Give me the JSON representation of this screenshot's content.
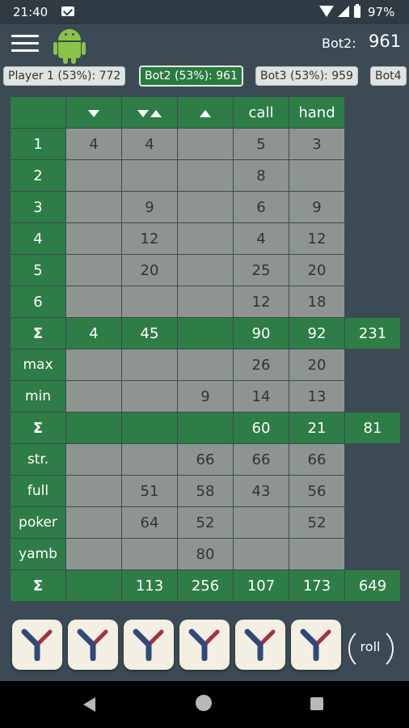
{
  "status_bar": {
    "time": "21:40",
    "battery": "97%"
  },
  "header": {
    "current_player_label": "Bot2:",
    "current_player_score": "961"
  },
  "tabs": [
    {
      "label": "Player 1 (53%): 772",
      "active": false
    },
    {
      "label": "Bot2 (53%): 961",
      "active": true
    },
    {
      "label": "Bot3 (53%): 959",
      "active": false
    },
    {
      "label": "Bot4",
      "active": false
    }
  ],
  "columns": [
    "down-icon",
    "free-icon",
    "up-icon",
    "call",
    "hand"
  ],
  "rows": {
    "1": [
      "4",
      "4",
      "",
      "5",
      "3"
    ],
    "2": [
      "",
      "",
      "",
      "8",
      ""
    ],
    "3": [
      "",
      "9",
      "",
      "6",
      "9"
    ],
    "4": [
      "",
      "12",
      "",
      "4",
      "12"
    ],
    "5": [
      "",
      "20",
      "",
      "25",
      "20"
    ],
    "6": [
      "",
      "",
      "",
      "12",
      "18"
    ],
    "sum1": [
      "4",
      "45",
      "",
      "90",
      "92",
      "231"
    ],
    "max": [
      "",
      "",
      "",
      "26",
      "20"
    ],
    "min": [
      "",
      "",
      "9",
      "14",
      "13"
    ],
    "sum2": [
      "",
      "",
      "",
      "60",
      "21",
      "81"
    ],
    "str": [
      "",
      "",
      "66",
      "66",
      "66"
    ],
    "full": [
      "",
      "51",
      "58",
      "43",
      "56"
    ],
    "poker": [
      "",
      "64",
      "52",
      "",
      "52"
    ],
    "yamb": [
      "",
      "",
      "80",
      "",
      ""
    ],
    "sum3": [
      "",
      "113",
      "256",
      "107",
      "173",
      "649"
    ]
  },
  "labels": {
    "r1": "1",
    "r2": "2",
    "r3": "3",
    "r4": "4",
    "r5": "5",
    "r6": "6",
    "sigma": "Σ",
    "max": "max",
    "min": "min",
    "str": "str.",
    "full": "full",
    "poker": "poker",
    "yamb": "yamb",
    "call": "call",
    "hand": "hand"
  },
  "dice": [
    "Y",
    "Y",
    "Y",
    "Y",
    "Y",
    "Y"
  ],
  "roll_label": "roll"
}
